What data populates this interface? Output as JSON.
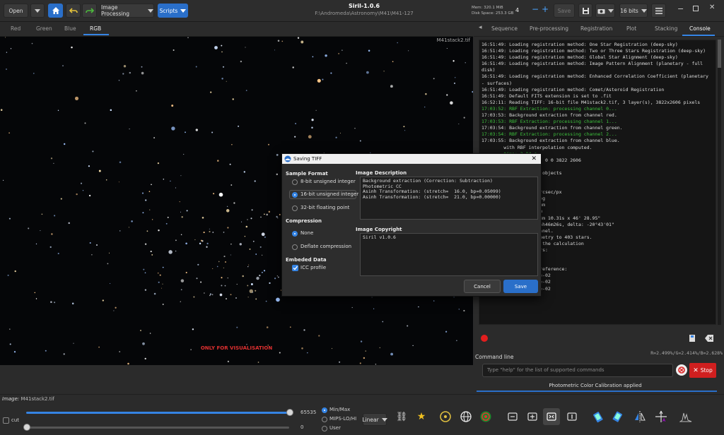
{
  "header": {
    "open_label": "Open",
    "image_processing_label": "Image Processing",
    "scripts_label": "Scripts",
    "title": "Siril-1.0.6",
    "path": "F:\\Andromeda\\Astronomy\\M41\\M41-127",
    "mem_label": "Mem: 320.1 MiB",
    "disk_label": "Disk Space: 253.3 GB",
    "threads_value": "4",
    "save_label": "Save",
    "bit_depth_label": "16 bits"
  },
  "channel_tabs": [
    "Red",
    "Green",
    "Blue",
    "RGB"
  ],
  "image_view": {
    "filename": "M41stack2.tif",
    "visualisation_note": "ONLY FOR VISUALISATION",
    "rgb_readout": "R=2.499%/G=2.414%/B=2.628%"
  },
  "right_tabs": [
    "Sequence",
    "Pre-processing",
    "Registration",
    "Plot",
    "Stacking",
    "Console"
  ],
  "console_lines": [
    {
      "text": "16:51:49: Loading registration method: One Star Registration (deep-sky)",
      "color": "normal"
    },
    {
      "text": "16:51:49: Loading registration method: Two or Three Stars Registration (deep-sky)",
      "color": "normal"
    },
    {
      "text": "16:51:49: Loading registration method: Global Star Alignment (deep-sky)",
      "color": "normal"
    },
    {
      "text": "16:51:49: Loading registration method: Image Pattern Alignment (planetary - full disk)",
      "color": "normal"
    },
    {
      "text": "16:51:49: Loading registration method: Enhanced Correlation Coefficient (planetary - surfaces)",
      "color": "normal"
    },
    {
      "text": "16:51:49: Loading registration method: Comet/Asteroid Registration",
      "color": "normal"
    },
    {
      "text": "16:51:49: Default FITS extension is set to .fit",
      "color": "normal"
    },
    {
      "text": "16:52:11: Reading TIFF: 16-bit file M41stack2.tif, 3 layer(s), 3822x2606 pixels",
      "color": "normal"
    },
    {
      "text": "17:03:52: RBF Extraction: processing channel 0...",
      "color": "green"
    },
    {
      "text": "17:03:53: Background extraction from channel red.",
      "color": "normal"
    },
    {
      "text": "17:03:53: RBF Extraction: processing channel 1...",
      "color": "green"
    },
    {
      "text": "17:03:54: Background extraction from channel green.",
      "color": "normal"
    },
    {
      "text": "17:03:54: RBF Extraction: processing channel 2...",
      "color": "green"
    },
    {
      "text": "17:03:55: Background extraction from channel blue.",
      "color": "normal"
    },
    {
      "text": "        with RBF interpolation computed.",
      "color": "normal"
    },
    {
      "text": "        time: 2.84 s.",
      "color": "green"
    },
    {
      "text": "        selected area: 0 0 3822 2606",
      "color": "normal"
    },
    {
      "text": "        processing...",
      "color": "green"
    },
    {
      "text": "        ASS size: 863 objects",
      "color": "normal"
    },
    {
      "text": "        atches.",
      "color": "normal"
    },
    {
      "text": "               0.924",
      "color": "normal"
    },
    {
      "text": "              1.070 arcsec/px",
      "color": "normal"
    },
    {
      "text": "             +86.47 deg",
      "color": "normal"
    },
    {
      "text": "              886.58 mm",
      "color": "normal"
    },
    {
      "text": "        :      4.60 µm",
      "color": "normal"
    },
    {
      "text": "        iew:    01d 08m 10.31s x 46' 28.95\"",
      "color": "normal"
    },
    {
      "text": "        er: alpha:  06h46m26s, delta: -20°43'01\"",
      "color": "normal"
    },
    {
      "text": "        g on blue channel.",
      "color": "normal"
    },
    {
      "text": "        perture photometry to 403 stars.",
      "color": "normal"
    },
    {
      "text": "        excluded from the calculation",
      "color": "normal"
    },
    {
      "text": "        oration factors:",
      "color": "normal"
    },
    {
      "text": "",
      "color": "normal"
    },
    {
      "text": "",
      "color": "normal"
    },
    {
      "text": "17:27:04: Background reference:",
      "color": "normal"
    },
    {
      "text": "17:27:04: B0: 2.01634e-02",
      "color": "normal"
    },
    {
      "text": "17:27:04: B1: 2.55589e-02",
      "color": "normal"
    },
    {
      "text": "17:27:04: B2: 5.19875e-02",
      "color": "normal"
    }
  ],
  "command": {
    "label": "Command line",
    "placeholder": "Type \"help\" for the list of supported commands",
    "stop_label": "Stop"
  },
  "status_line": "Photometric Color Calibration applied",
  "bottom": {
    "image_label": "Image:",
    "image_name": "M41stack2.tif",
    "cut_label": "cut",
    "max_value": "65535",
    "min_value": "0",
    "minmax_label": "Min/Max",
    "mips_label": "MIPS-LO/HI",
    "user_label": "User",
    "linear_label": "Linear"
  },
  "dialog": {
    "title": "Saving TIFF",
    "sample_format_label": "Sample Format",
    "formats": [
      "8-bit unsigned integer",
      "16-bit unsigned integer",
      "32-bit floating point"
    ],
    "selected_format": "16-bit unsigned integer",
    "compression_label": "Compression",
    "compressions": [
      "None",
      "Deflate compression"
    ],
    "selected_compression": "None",
    "embeded_label": "Embeded Data",
    "icc_label": "ICC profile",
    "icc_checked": true,
    "description_label": "Image Description",
    "description_text": "Background extraction (Correction: Subtraction)\nPhotometric CC\nAsinh Transformation: (stretch=  16.0, bp=0.05099)\nAsinh Transformation: (stretch=  21.0, bp=0.00000)",
    "copyright_label": "Image Copyright",
    "copyright_text": "Siril v1.0.6",
    "cancel_label": "Cancel",
    "save_label": "Save"
  }
}
